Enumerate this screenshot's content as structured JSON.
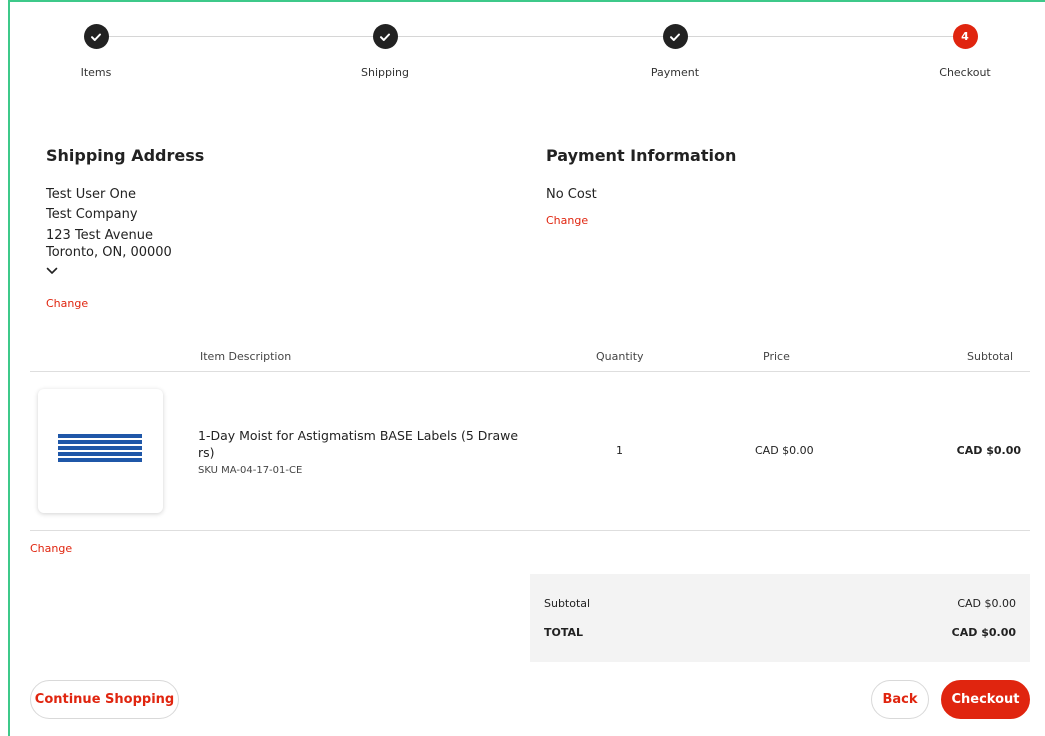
{
  "stepper": {
    "steps": [
      {
        "label": "Items",
        "state": "complete",
        "icon": "check-icon"
      },
      {
        "label": "Shipping",
        "state": "complete",
        "icon": "check-icon"
      },
      {
        "label": "Payment",
        "state": "complete",
        "icon": "check-icon"
      },
      {
        "label": "Checkout",
        "state": "active",
        "number": "4"
      }
    ]
  },
  "shipping": {
    "title": "Shipping Address",
    "lines": [
      "Test User One",
      "Test Company",
      "123 Test Avenue",
      "Toronto, ON, 00000"
    ],
    "expand_icon": "chevron-down-icon",
    "change_label": "Change"
  },
  "payment": {
    "title": "Payment Information",
    "method": "No Cost",
    "change_label": "Change"
  },
  "table": {
    "headers": {
      "description": "Item Description",
      "quantity": "Quantity",
      "price": "Price",
      "subtotal": "Subtotal"
    },
    "items": [
      {
        "name": "1-Day Moist for Astigmatism BASE Labels (5 Drawe rs)",
        "sku": "SKU MA-04-17-01-CE",
        "quantity": "1",
        "price": "CAD $0.00",
        "subtotal": "CAD $0.00"
      }
    ],
    "change_label": "Change"
  },
  "summary": {
    "subtotal_label": "Subtotal",
    "subtotal_value": "CAD $0.00",
    "total_label": "TOTAL",
    "total_value": "CAD $0.00"
  },
  "actions": {
    "continue_label": "Continue Shopping",
    "back_label": "Back",
    "checkout_label": "Checkout"
  },
  "colors": {
    "accent": "#e0250f",
    "dark": "#222222",
    "frame": "#3ec98a",
    "summary_bg": "#f3f3f3"
  }
}
